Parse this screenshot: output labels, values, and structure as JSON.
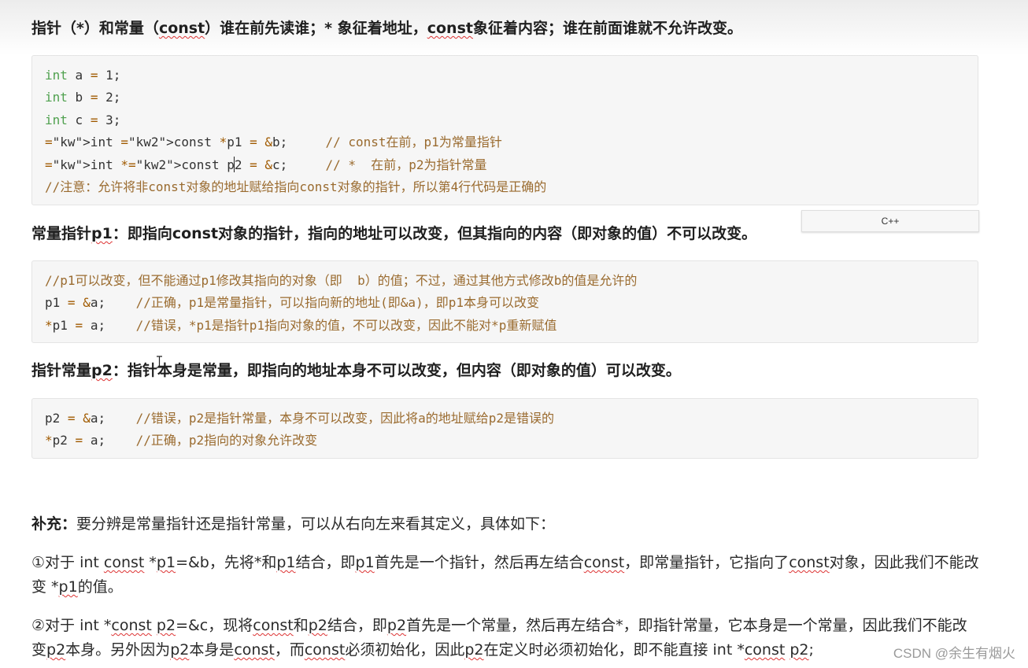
{
  "heading1": {
    "part1": "指针（*）和常量（",
    "const_word": "const",
    "part2": "）谁在前先读谁；* 象征着地址，",
    "const_word2": "const",
    "part3": "象征着内容；谁在前面谁就不允许改变。"
  },
  "code_block1": {
    "lines": [
      {
        "k": "int",
        "rest": " a = 1;"
      },
      {
        "k": "int",
        "rest": " b = 2;"
      },
      {
        "k": "int",
        "rest": " c = 3;"
      }
    ],
    "line4": {
      "code": "int const *p1 = &b;",
      "comment": "// const在前，p1为常量指针"
    },
    "line5": {
      "code_before_cursor": "int *const p",
      "code_after_cursor": "2 = &c;",
      "comment": "// *  在前，p2为指针常量"
    },
    "line6": {
      "comment": "//注意：允许将非const对象的地址赋给指向const对象的指针，所以第4行代码是正确的"
    }
  },
  "lang_tab": {
    "label": "C++"
  },
  "heading2": {
    "part1": "常量指针",
    "p1": "p1",
    "part2": "：即指向const对象的指针，指向的地址可以改变，但其指向的内容（即对象的值）不可以改变。"
  },
  "code_block2": {
    "line1": {
      "comment": "//p1可以改变，但不能通过p1修改其指向的对象（即  b）的值；不过，通过其他方式修改b的值是允许的"
    },
    "line2": {
      "code": "p1 = &a;",
      "comment": "//正确，p1是常量指针，可以指向新的地址(即&a)，即p1本身可以改变"
    },
    "line3": {
      "code": "*p1 = a;",
      "comment": "//错误，*p1是指针p1指向对象的值，不可以改变，因此不能对*p重新赋值"
    }
  },
  "heading3": {
    "part1": "指针常量",
    "p2": "p2",
    "part2": "：指针本身是常量，即指向的地址本身不可以改变，但内容（即对象的值）可以改变。"
  },
  "code_block3": {
    "line1": {
      "code": "p2 = &a;",
      "comment": "//错误，p2是指针常量，本身不可以改变，因此将a的地址赋给p2是错误的"
    },
    "line2": {
      "code": "*p2 = a;",
      "comment": "//正确，p2指向的对象允许改变"
    }
  },
  "supplement": {
    "label": "补充：",
    "text": "要分辨是常量指针还是指针常量，可以从右向左来看其定义，具体如下："
  },
  "point1": {
    "a": "①对于 int ",
    "const1": "const",
    "b": " *",
    "p1a": "p1",
    "c": "=&b，先将*和",
    "p1b": "p1",
    "d": "结合，即",
    "p1c": "p1",
    "e": "首先是一个指针，然后再左结合",
    "const2": "const",
    "f": "，即常量指针，它指向了",
    "const3": "const",
    "g": "对象，因此我们不能改变 *",
    "p1d": "p1",
    "h": "的值。"
  },
  "point2": {
    "a": "②对于 int *",
    "const1": "const",
    "b": " ",
    "p2a": "p2",
    "c": "=&c，现将",
    "const2": "const",
    "d": "和",
    "p2b": "p2",
    "e": "结合，即",
    "p2c": "p2",
    "f": "首先是一个常量，然后再左结合*，即指针常量，它本身是一个常量，因此我们不能改变",
    "p2d": "p2",
    "g": "本身。另外因为",
    "p2e": "p2",
    "h": "本身是",
    "const3": "const",
    "i": "，而",
    "const4": "const",
    "j": "必须初始化，因此",
    "p2f": "p2",
    "k": "在定义时必须初始化，即不能直接 int *",
    "const5": "const",
    "l": " ",
    "p2g": "p2",
    "m": ";"
  },
  "watermark": {
    "text": "CSDN @余生有烟火"
  }
}
